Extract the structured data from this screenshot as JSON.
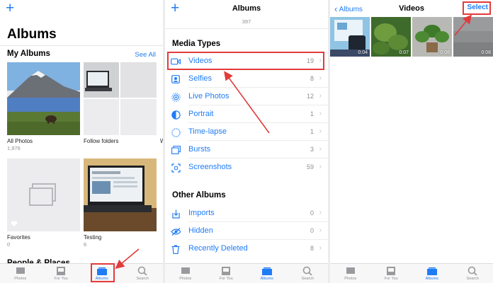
{
  "panel1": {
    "nav": {
      "plus_icon": "plus-icon"
    },
    "title": "Albums",
    "my_albums": {
      "heading": "My Albums",
      "see_all": "See All"
    },
    "albums": [
      {
        "name": "All Photos",
        "count": "1,976"
      },
      {
        "name": "Follow folders",
        "count": ""
      },
      {
        "name": "W",
        "count": ""
      },
      {
        "name": "Favorites",
        "count": "0"
      },
      {
        "name": "Testing",
        "count": "6"
      }
    ],
    "people_heading": "People & Places"
  },
  "panel2": {
    "nav_title": "Albums",
    "top_count": "397",
    "media_types_heading": "Media Types",
    "media_types": [
      {
        "label": "Videos",
        "count": "19",
        "icon": "video-icon"
      },
      {
        "label": "Selfies",
        "count": "8",
        "icon": "selfie-icon"
      },
      {
        "label": "Live Photos",
        "count": "12",
        "icon": "live-photo-icon"
      },
      {
        "label": "Portrait",
        "count": "1",
        "icon": "portrait-icon"
      },
      {
        "label": "Time-lapse",
        "count": "1",
        "icon": "timelapse-icon"
      },
      {
        "label": "Bursts",
        "count": "3",
        "icon": "bursts-icon"
      },
      {
        "label": "Screenshots",
        "count": "59",
        "icon": "screenshot-icon"
      }
    ],
    "other_albums_heading": "Other Albums",
    "other_albums": [
      {
        "label": "Imports",
        "count": "0",
        "icon": "import-icon"
      },
      {
        "label": "Hidden",
        "count": "0",
        "icon": "hidden-icon"
      },
      {
        "label": "Recently Deleted",
        "count": "8",
        "icon": "trash-icon"
      }
    ]
  },
  "panel3": {
    "back_label": "Albums",
    "title": "Videos",
    "select_label": "Select",
    "videos": [
      {
        "duration": "0:04"
      },
      {
        "duration": "0:07"
      },
      {
        "duration": "0:08"
      },
      {
        "duration": "0:08"
      }
    ]
  },
  "tabbar": {
    "tabs": [
      {
        "label": "Photos"
      },
      {
        "label": "For You"
      },
      {
        "label": "Albums"
      },
      {
        "label": "Search"
      }
    ],
    "active_index": 2
  },
  "colors": {
    "accent": "#1f7cf6",
    "annotation": "#e23b3b",
    "secondary_text": "#8e8e93"
  }
}
